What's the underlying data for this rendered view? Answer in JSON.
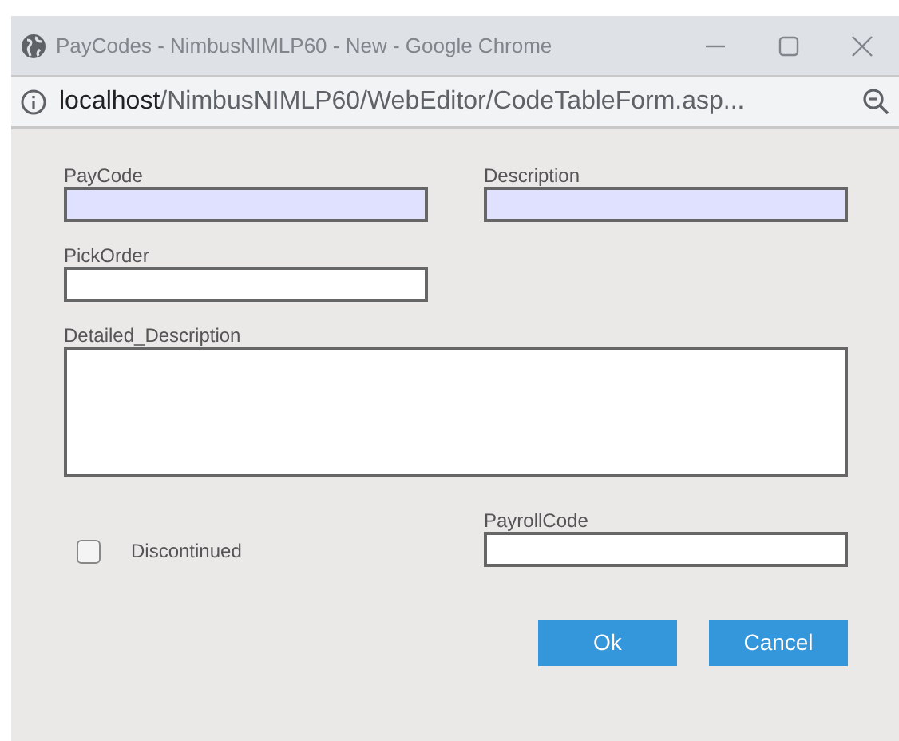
{
  "window": {
    "title": "PayCodes - NimbusNIMLP60 - New - Google Chrome"
  },
  "address_bar": {
    "url": "localhost/NimbusNIMLP60/WebEditor/CodeTableForm.asp..."
  },
  "fields": [
    {
      "label": "PayCode",
      "kind": "input",
      "required": true
    },
    {
      "label": "Description",
      "kind": "input",
      "required": true
    },
    {
      "label": "PickOrder",
      "kind": "input",
      "required": false
    },
    {
      "label": "Detailed_Description",
      "kind": "textarea",
      "required": false
    }
  ],
  "discontinued": {
    "label": "Discontinued",
    "checked": false
  },
  "payroll_code": {
    "label": "PayrollCode",
    "required": false
  },
  "buttons": [
    "Ok",
    "Cancel"
  ]
}
